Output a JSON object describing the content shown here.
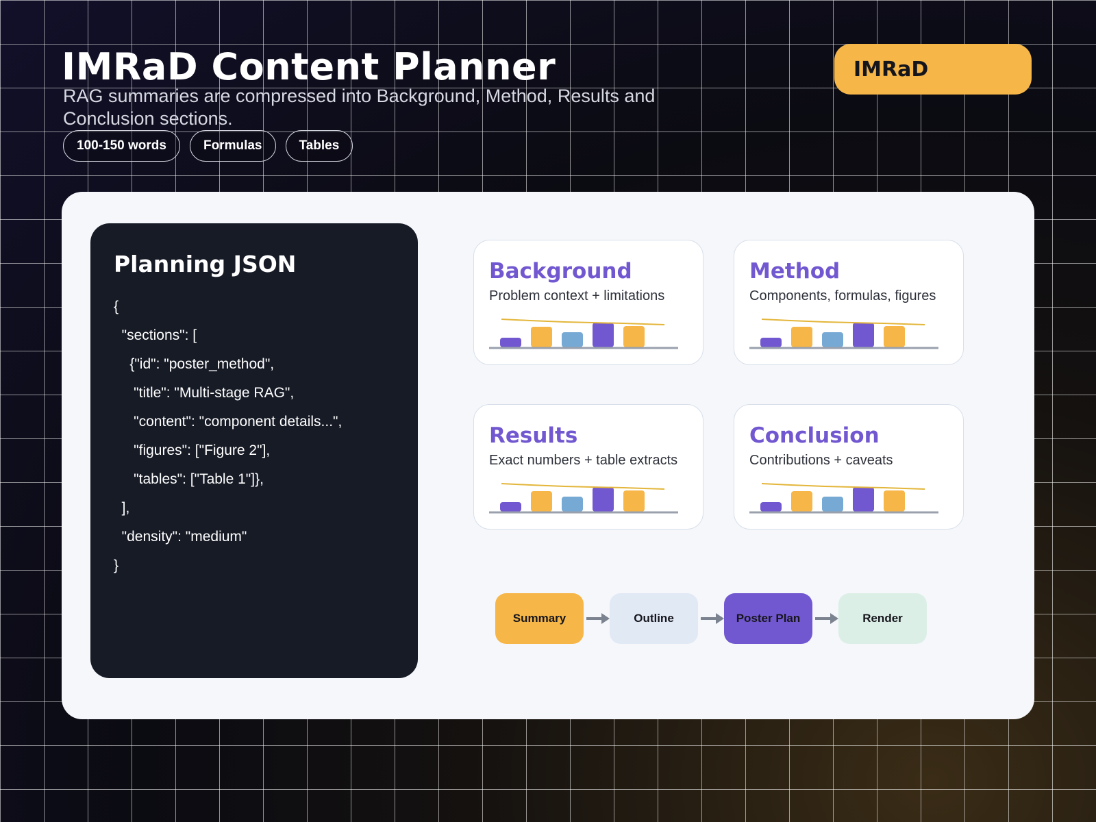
{
  "header": {
    "title": "IMRaD Content Planner",
    "subtitle": "RAG summaries are compressed into Background, Method, Results and Conclusion sections.",
    "badge": "IMRaD",
    "tags": [
      "100-150 words",
      "Formulas",
      "Tables"
    ]
  },
  "json_card": {
    "title": "Planning JSON",
    "lines": [
      "{",
      "  \"sections\": [",
      "    {\"id\": \"poster_method\",",
      "     \"title\": \"Multi-stage RAG\",",
      "     \"content\": \"component details...\",",
      "     \"figures\": [\"Figure 2\"],",
      "     \"tables\": [\"Table 1\"]},",
      "  ],",
      "  \"density\": \"medium\"",
      "}"
    ]
  },
  "sections": [
    {
      "title": "Background",
      "desc": "Problem context + limitations"
    },
    {
      "title": "Method",
      "desc": "Components, formulas, figures"
    },
    {
      "title": "Results",
      "desc": "Exact numbers + table extracts"
    },
    {
      "title": "Conclusion",
      "desc": "Contributions + caveats"
    }
  ],
  "flow": [
    {
      "label": "Summary",
      "color": "#f6b648"
    },
    {
      "label": "Outline",
      "color": "#e1e9f5"
    },
    {
      "label": "Poster Plan",
      "color": "#7258d0"
    },
    {
      "label": "Render",
      "color": "#dcefe6"
    }
  ],
  "colors": {
    "accent_purple": "#7258d0",
    "accent_orange": "#f6b648",
    "accent_blue": "#76a9d3",
    "trend_line": "#e3b63a"
  }
}
